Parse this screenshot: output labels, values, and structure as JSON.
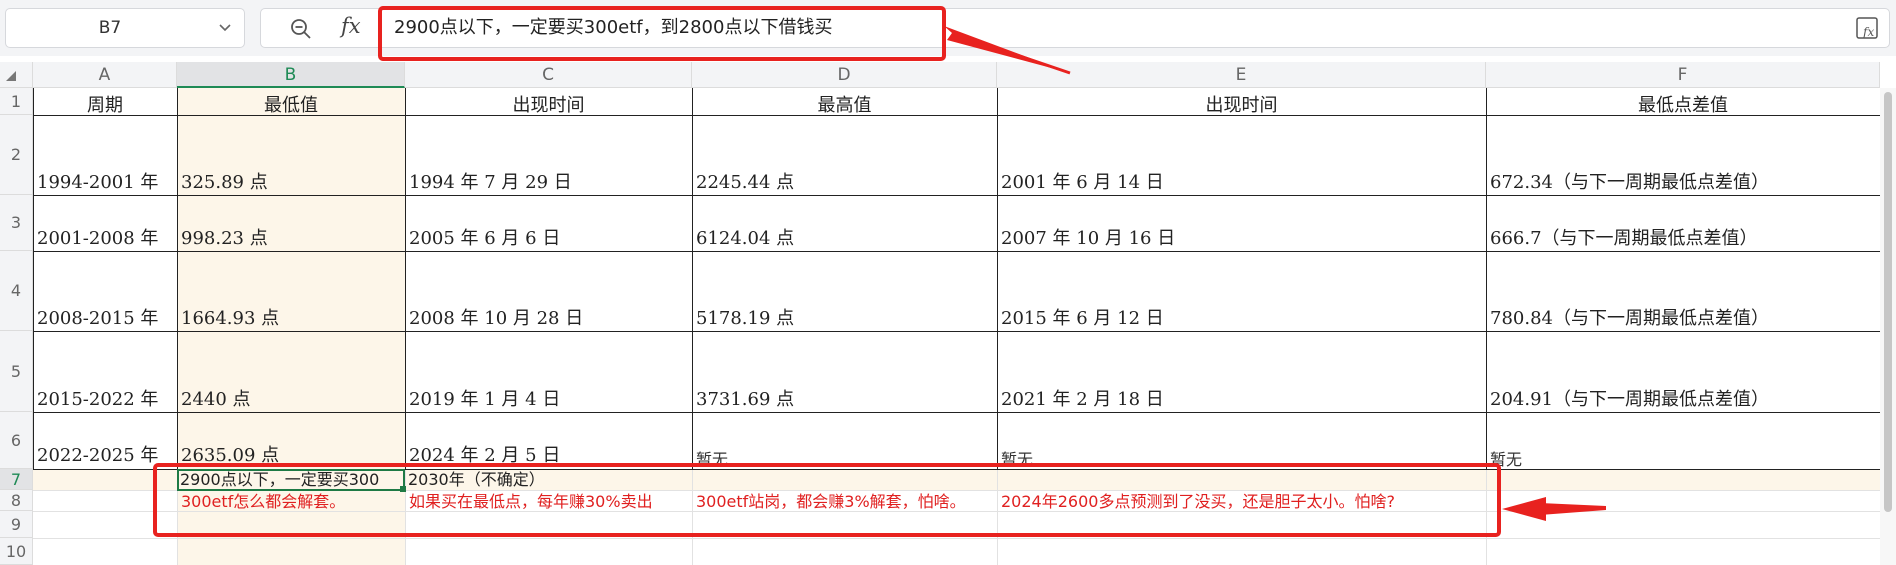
{
  "formula_bar": {
    "name_box": "B7",
    "fx_label": "fx",
    "content": "2900点以下，一定要买300etf，到2800点以下借钱买"
  },
  "columns": [
    "A",
    "B",
    "C",
    "D",
    "E",
    "F"
  ],
  "rows": [
    "1",
    "2",
    "3",
    "4",
    "5",
    "6",
    "7",
    "8",
    "9",
    "10"
  ],
  "headers": {
    "a": "周期",
    "b": "最低值",
    "c": "出现时间",
    "d": "最高值",
    "e": "出现时间",
    "f": "最低点差值"
  },
  "data_rows": [
    {
      "period": "1994-2001 年",
      "low": "325.89 点",
      "low_date": "1994 年 7 月 29 日",
      "high": "2245.44 点",
      "high_date": "2001 年 6 月 14 日",
      "diff": "672.34（与下一周期最低点差值）"
    },
    {
      "period": "2001-2008 年",
      "low": "998.23 点",
      "low_date": "2005 年 6 月 6 日",
      "high": "6124.04 点",
      "high_date": "2007 年 10 月 16 日",
      "diff": "666.7（与下一周期最低点差值）"
    },
    {
      "period": "2008-2015 年",
      "low": "1664.93 点",
      "low_date": "2008 年 10 月 28 日",
      "high": "5178.19 点",
      "high_date": "2015 年 6 月 12 日",
      "diff": "780.84（与下一周期最低点差值）"
    },
    {
      "period": "2015-2022 年",
      "low": "2440 点",
      "low_date": "2019 年 1 月 4 日",
      "high": "3731.69 点",
      "high_date": "2021 年 2 月 18 日",
      "diff": "204.91（与下一周期最低点差值）"
    },
    {
      "period": "2022-2025 年",
      "low": "2635.09 点",
      "low_date": "2024 年 2 月 5 日",
      "high": "暂无",
      "high_date": "暂无",
      "diff": "暂无"
    }
  ],
  "row7": {
    "b": "2900点以下，一定要买300",
    "c": "2030年（不确定）"
  },
  "row8": {
    "b": "300etf怎么都会解套。",
    "c": "如果买在最低点，每年赚30%卖出",
    "d": "300etf站岗，都会赚3%解套，怕啥。",
    "e": "2024年2600多点预测到了没买，还是胆子太小。怕啥?"
  },
  "annotation_color": "#e8221f",
  "accent_color": "#1e8a55"
}
